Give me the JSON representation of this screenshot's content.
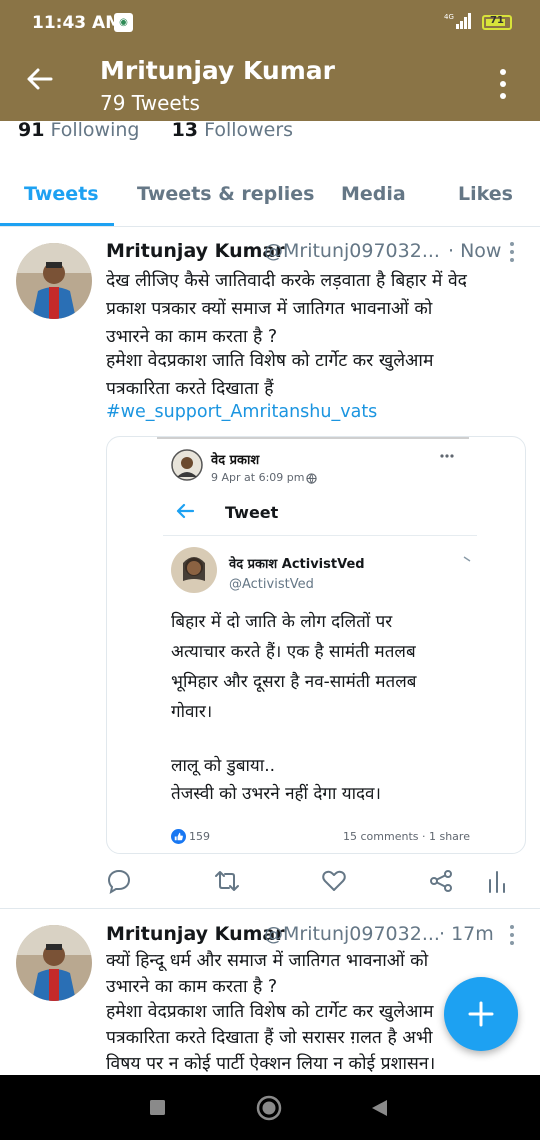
{
  "status_bar": {
    "time": "11:43 AM",
    "battery": "71",
    "network": "4G"
  },
  "header": {
    "name": "Mritunjay Kumar",
    "tweets_count": "79 Tweets",
    "background_color": "#8a7446"
  },
  "profile_stats": {
    "following_count": "91",
    "following_label": "Following",
    "followers_count": "13",
    "followers_label": "Followers"
  },
  "tabs": [
    {
      "label": "Tweets",
      "active": true
    },
    {
      "label": "Tweets & replies",
      "active": false
    },
    {
      "label": "Media",
      "active": false
    },
    {
      "label": "Likes",
      "active": false
    }
  ],
  "tweets": [
    {
      "name": "Mritunjay Kumar",
      "handle": "@Mritunj097032...",
      "time": "· Now",
      "lines": [
        "देख लीजिए कैसे जातिवादी करके लड़वाता है बिहार में वेद",
        "प्रकाश पत्रकार क्यों समाज में जातिगत भावनाओं को",
        "उभारने का काम करता है ?",
        "हमेशा वेदप्रकाश जाति विशेष को टार्गेट कर खुलेआम",
        "पत्रकारिता करते दिखाता हैं"
      ],
      "hashtag": "#we_support_Amritanshu_vats",
      "card": {
        "poster_name": "वेद प्रकाश",
        "post_time": "9 Apr at 6:09 pm ·",
        "inner_header": "Tweet",
        "quoted_name": "वेद प्रकाश ActivistVed",
        "quoted_handle": "@ActivistVed",
        "quoted_lines": [
          "बिहार में दो जाति के लोग दलितों पर",
          "अत्याचार करते हैं। एक है सामंती मतलब",
          "भूमिहार और दूसरा है नव-सामंती मतलब",
          "गोवार।",
          "",
          "लालू को डुबाया..",
          "तेजस्वी को उभरने नहीं देगा यादव।"
        ],
        "reactions": "159",
        "comments_shares": "15 comments · 1 share"
      }
    },
    {
      "name": "Mritunjay Kumar",
      "handle": "@Mritunj097032...",
      "time": "· 17m",
      "lines": [
        "क्यों हिन्दू धर्म और समाज में जातिगत भावनाओं को",
        "उभारने का काम करता है ?",
        "हमेशा वेदप्रकाश जाति विशेष को टार्गेट कर खुलेआम",
        "पत्रकारिता करते दिखाता हैं जो सरासर ग़लत है अभी",
        "विषय पर न कोई पार्टी ऐक्शन लिया न कोई प्रशासन।"
      ]
    }
  ],
  "accent_color": "#1da1f2"
}
